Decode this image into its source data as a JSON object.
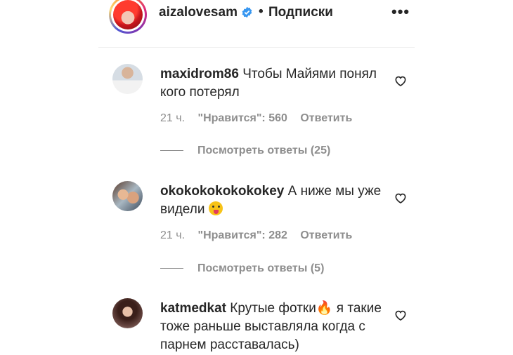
{
  "header": {
    "username": "aizalovesam",
    "separator": "•",
    "follow_label": "Подписки",
    "more_label": "•••",
    "verified_icon": "verified-badge-icon"
  },
  "comments": [
    {
      "username": "maxidrom86",
      "text": "Чтобы Майями понял кого потерял",
      "time": "21 ч.",
      "likes": "\"Нравится\": 560",
      "reply": "Ответить",
      "view_replies": "Посмотреть ответы (25)"
    },
    {
      "username": "okokokokokokokey",
      "text": "А ниже мы уже видели",
      "emoji": "tongue-emoji",
      "time": "21 ч.",
      "likes": "\"Нравится\": 282",
      "reply": "Ответить",
      "view_replies": "Посмотреть ответы (5)"
    },
    {
      "username": "katmedkat",
      "text_before_emoji": "Крутые фотки",
      "emoji": "🔥",
      "text_after_emoji": " я такие тоже раньше выставляла когда с парнем расставалась)"
    }
  ],
  "colors": {
    "text": "#262626",
    "secondary": "#8e8e8e",
    "verified": "#3897f0"
  }
}
